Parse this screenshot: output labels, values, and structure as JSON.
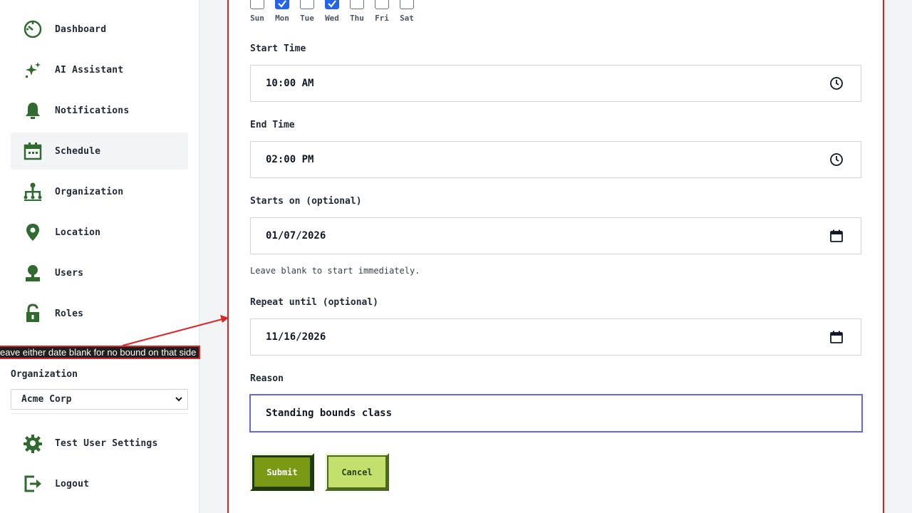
{
  "sidebar": {
    "items": [
      {
        "label": "Dashboard",
        "icon": "dashboard-icon"
      },
      {
        "label": "AI Assistant",
        "icon": "sparkle-icon"
      },
      {
        "label": "Notifications",
        "icon": "bell-icon"
      },
      {
        "label": "Schedule",
        "icon": "calendar-icon"
      },
      {
        "label": "Organization",
        "icon": "org-chart-icon"
      },
      {
        "label": "Location",
        "icon": "location-pin-icon"
      },
      {
        "label": "Users",
        "icon": "user-icon"
      },
      {
        "label": "Roles",
        "icon": "unlock-icon"
      }
    ],
    "active": "Schedule",
    "organization_label": "Organization",
    "organization_value": "Acme Corp",
    "bottom_items": [
      {
        "label": "Test User Settings",
        "icon": "gear-icon"
      },
      {
        "label": "Logout",
        "icon": "logout-icon"
      }
    ]
  },
  "form": {
    "days": [
      {
        "label": "Sun",
        "checked": false
      },
      {
        "label": "Mon",
        "checked": true
      },
      {
        "label": "Tue",
        "checked": false
      },
      {
        "label": "Wed",
        "checked": true
      },
      {
        "label": "Thu",
        "checked": false
      },
      {
        "label": "Fri",
        "checked": false
      },
      {
        "label": "Sat",
        "checked": false
      }
    ],
    "start_time_label": "Start Time",
    "start_time_value": "10:00 AM",
    "end_time_label": "End Time",
    "end_time_value": "02:00 PM",
    "starts_on_label": "Starts on (optional)",
    "starts_on_value": "01/07/2026",
    "starts_on_help": "Leave blank to start immediately.",
    "repeat_until_label": "Repeat until (optional)",
    "repeat_until_value": "11/16/2026",
    "reason_label": "Reason",
    "reason_value": "Standing bounds class",
    "submit_label": "Submit",
    "cancel_label": "Cancel"
  },
  "annotation": {
    "text": "eave either date blank for no bound on that side"
  },
  "colors": {
    "accent_green": "#2f6b2f",
    "checkbox_blue": "#2563eb",
    "annotation_red": "#dc2626",
    "focus_indigo": "#6366f1",
    "submit_green": "#7a9a16",
    "cancel_green": "#c3e06c"
  }
}
